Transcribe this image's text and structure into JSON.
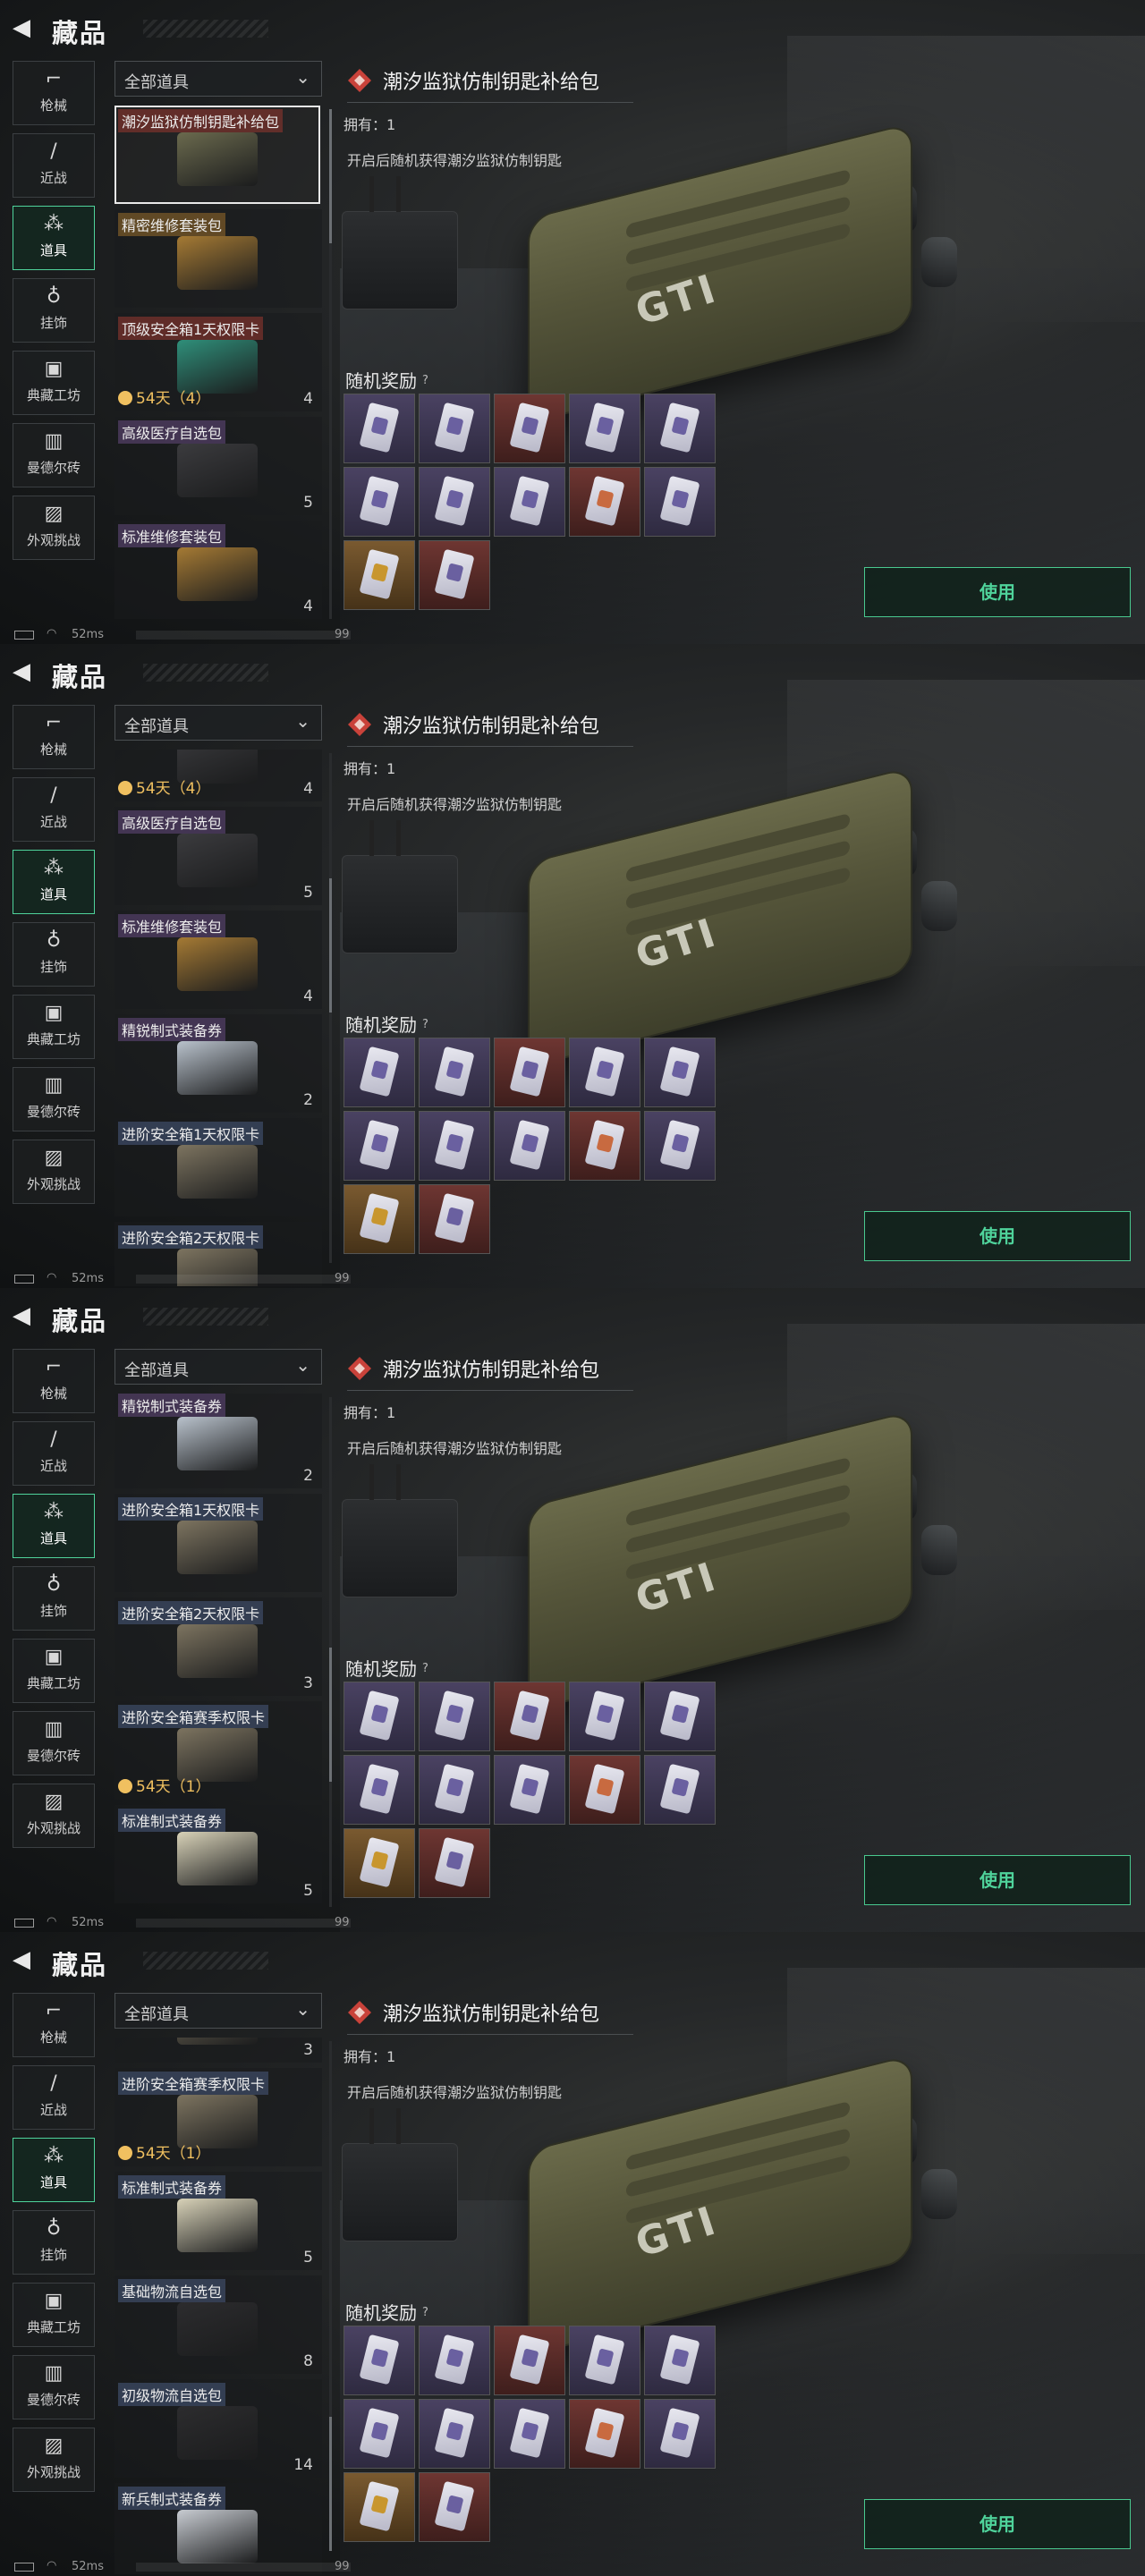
{
  "header": {
    "title": "藏品",
    "back_icon": "back-arrow-icon"
  },
  "nav": [
    {
      "label": "枪械",
      "icon": "gun-icon",
      "glyph": "⌐"
    },
    {
      "label": "近战",
      "icon": "knife-icon",
      "glyph": "/"
    },
    {
      "label": "道具",
      "icon": "items-icon",
      "glyph": "⁂",
      "active": true
    },
    {
      "label": "挂饰",
      "icon": "charm-icon",
      "glyph": "♁"
    },
    {
      "label": "典藏工坊",
      "icon": "workshop-icon",
      "glyph": "▣"
    },
    {
      "label": "曼德尔砖",
      "icon": "brick-icon",
      "glyph": "▥"
    },
    {
      "label": "外观挑战",
      "icon": "challenge-icon",
      "glyph": "▨"
    }
  ],
  "filter": {
    "label": "全部道具"
  },
  "detail": {
    "title": "潮汐监狱仿制钥匙补给包",
    "owned": "拥有：1",
    "description": "开启后随机获得潮汐监狱仿制钥匙",
    "rewards_label": "随机奖励",
    "rewards_help": "?",
    "use_button": "使用",
    "crate_logo": "GTI"
  },
  "rewards": [
    "purple",
    "purple",
    "red",
    "purple",
    "purple",
    "purple",
    "purple",
    "purple",
    "red",
    "purple",
    "gold",
    "red"
  ],
  "status": {
    "ping": "52ms",
    "right_num": "99"
  },
  "screens": [
    {
      "items": [
        {
          "name": "潮汐监狱仿制钥匙补给包",
          "quality": "red",
          "color": "#6b6a4e",
          "selected": true
        },
        {
          "name": "精密维修套装包",
          "quality": "gold",
          "color": "#a57a34"
        },
        {
          "name": "顶级安全箱1天权限卡",
          "quality": "red",
          "color": "#2f8f7a",
          "time": "54天（4）",
          "count": "4"
        },
        {
          "name": "高级医疗自选包",
          "quality": "purple",
          "color": "#3b3b3e",
          "count": "5"
        },
        {
          "name": "标准维修套装包",
          "quality": "purple",
          "color": "#a57a34",
          "count": "4"
        }
      ],
      "offset": 0,
      "thumb": 0
    },
    {
      "items": [
        {
          "name": "",
          "quality": "none",
          "color": "#3b3b3e",
          "time": "54天（4）",
          "count": "4"
        },
        {
          "name": "高级医疗自选包",
          "quality": "purple",
          "color": "#3b3b3e",
          "count": "5"
        },
        {
          "name": "标准维修套装包",
          "quality": "purple",
          "color": "#a57a34",
          "count": "4"
        },
        {
          "name": "精锐制式装备券",
          "quality": "purple",
          "color": "#b9c2cc",
          "count": "2"
        },
        {
          "name": "进阶安全箱1天权限卡",
          "quality": "blue",
          "color": "#7d7460"
        },
        {
          "name": "进阶安全箱2天权限卡",
          "quality": "blue",
          "color": "#7d7460"
        }
      ],
      "offset": -52,
      "thumb": 140
    },
    {
      "items": [
        {
          "name": "精锐制式装备券",
          "quality": "purple",
          "color": "#b9c2cc",
          "count": "2"
        },
        {
          "name": "进阶安全箱1天权限卡",
          "quality": "blue",
          "color": "#7d7460"
        },
        {
          "name": "进阶安全箱2天权限卡",
          "quality": "blue",
          "color": "#7d7460",
          "count": "3"
        },
        {
          "name": "进阶安全箱赛季权限卡",
          "quality": "blue",
          "color": "#7d7460",
          "time": "54天（1）"
        },
        {
          "name": "标准制式装备券",
          "quality": "blue",
          "color": "#d8d2b8",
          "count": "5"
        }
      ],
      "offset": -4,
      "thumb": 280
    },
    {
      "items": [
        {
          "name": "",
          "quality": "none",
          "color": "#7d7460",
          "count": "3"
        },
        {
          "name": "进阶安全箱赛季权限卡",
          "quality": "blue",
          "color": "#7d7460",
          "time": "54天（1）"
        },
        {
          "name": "标准制式装备券",
          "quality": "blue",
          "color": "#d8d2b8",
          "count": "5"
        },
        {
          "name": "基础物流自选包",
          "quality": "blue",
          "color": "#2c2c2e",
          "count": "8"
        },
        {
          "name": "初级物流自选包",
          "quality": "blue",
          "color": "#2c2c2e",
          "count": "14"
        },
        {
          "name": "新兵制式装备券",
          "quality": "blue",
          "color": "#c8ccd2"
        }
      ],
      "offset": -82,
      "thumb": 420
    }
  ]
}
